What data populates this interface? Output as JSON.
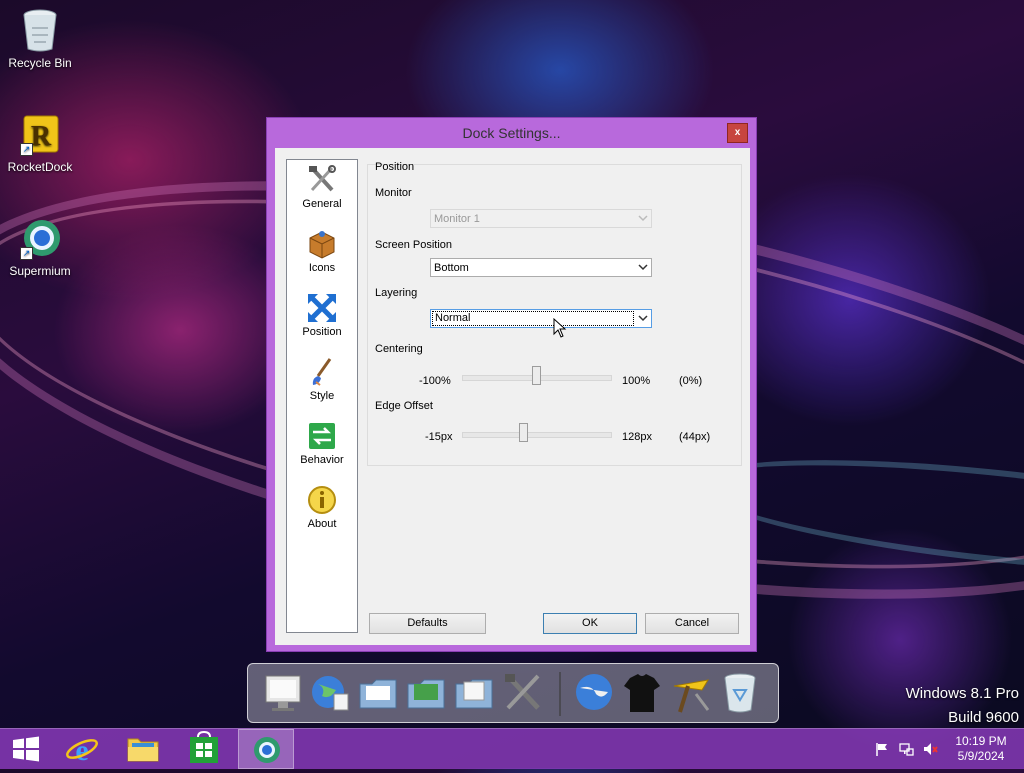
{
  "desktop": {
    "icons": [
      {
        "label": "Recycle Bin",
        "icon": "recycle-bin-icon"
      },
      {
        "label": "RocketDock",
        "icon": "rocketdock-icon"
      },
      {
        "label": "Supermium",
        "icon": "supermium-icon"
      }
    ]
  },
  "dialog": {
    "title": "Dock Settings...",
    "close_label": "x",
    "sidebar": [
      {
        "label": "General",
        "icon": "tools-icon"
      },
      {
        "label": "Icons",
        "icon": "box-icon"
      },
      {
        "label": "Position",
        "icon": "position-arrows-icon"
      },
      {
        "label": "Style",
        "icon": "paintbrush-icon"
      },
      {
        "label": "Behavior",
        "icon": "behavior-arrows-icon"
      },
      {
        "label": "About",
        "icon": "info-icon"
      }
    ],
    "group_title": "Position",
    "monitor": {
      "label": "Monitor",
      "value": "Monitor 1"
    },
    "screen_position": {
      "label": "Screen Position",
      "value": "Bottom"
    },
    "layering": {
      "label": "Layering",
      "value": "Normal"
    },
    "centering": {
      "label": "Centering",
      "min": "-100%",
      "max": "100%",
      "current": "(0%)",
      "value": 0
    },
    "edge_offset": {
      "label": "Edge Offset",
      "min": "-15px",
      "max": "128px",
      "current": "(44px)",
      "value": 44
    },
    "buttons": {
      "defaults": "Defaults",
      "ok": "OK",
      "cancel": "Cancel"
    }
  },
  "dock": {
    "items": [
      "monitor-icon",
      "internet-globe-icon",
      "folder-icon",
      "folder-green-icon",
      "folder-docs-icon",
      "dock-settings-icon",
      "supermium-globe-icon",
      "tshirt-icon",
      "rocketdock-tools-icon",
      "recycle-bin-icon"
    ]
  },
  "watermark": {
    "line1": "Windows 8.1 Pro",
    "line2": "Build 9600"
  },
  "taskbar": {
    "clock_time": "10:19 PM",
    "clock_date": "5/9/2024",
    "apps": [
      "start-icon",
      "internet-explorer-icon",
      "file-explorer-icon",
      "store-icon",
      "rocketdock-task-icon"
    ]
  },
  "colors": {
    "title_bar": "#b869dc",
    "taskbar": "#8c3cbe",
    "close": "#c7453f"
  }
}
